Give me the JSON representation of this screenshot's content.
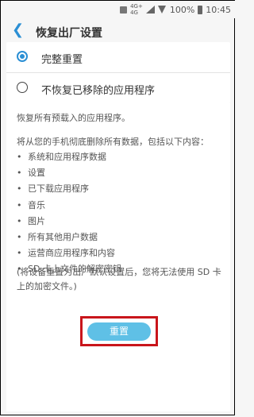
{
  "status_bar": {
    "network_small": "4G+",
    "network_small2": "4G",
    "battery": "100%",
    "time": "10:45"
  },
  "header": {
    "title": "恢复出厂设置"
  },
  "options": [
    {
      "label": "完整重置",
      "selected": true
    },
    {
      "label": "不恢复已移除的应用程序",
      "selected": false
    }
  ],
  "content": {
    "description": "恢复所有预载入的应用程序。",
    "intro": "将从您的手机彻底删除所有数据，包括以下内容：",
    "items": [
      "系统和应用程序数据",
      "设置",
      "已下载应用程序",
      "音乐",
      "图片",
      "所有其他用户数据",
      "运营商应用程序和内容",
      "SD 卡上文件的解密密钥"
    ],
    "note": "(将设备重置为出厂默认设置后，您将无法使用 SD 卡上的加密文件。)",
    "reset_button": "重置"
  },
  "colors": {
    "accent": "#2b8fd4",
    "button": "#5fc0e6",
    "highlight": "#c9151b"
  }
}
